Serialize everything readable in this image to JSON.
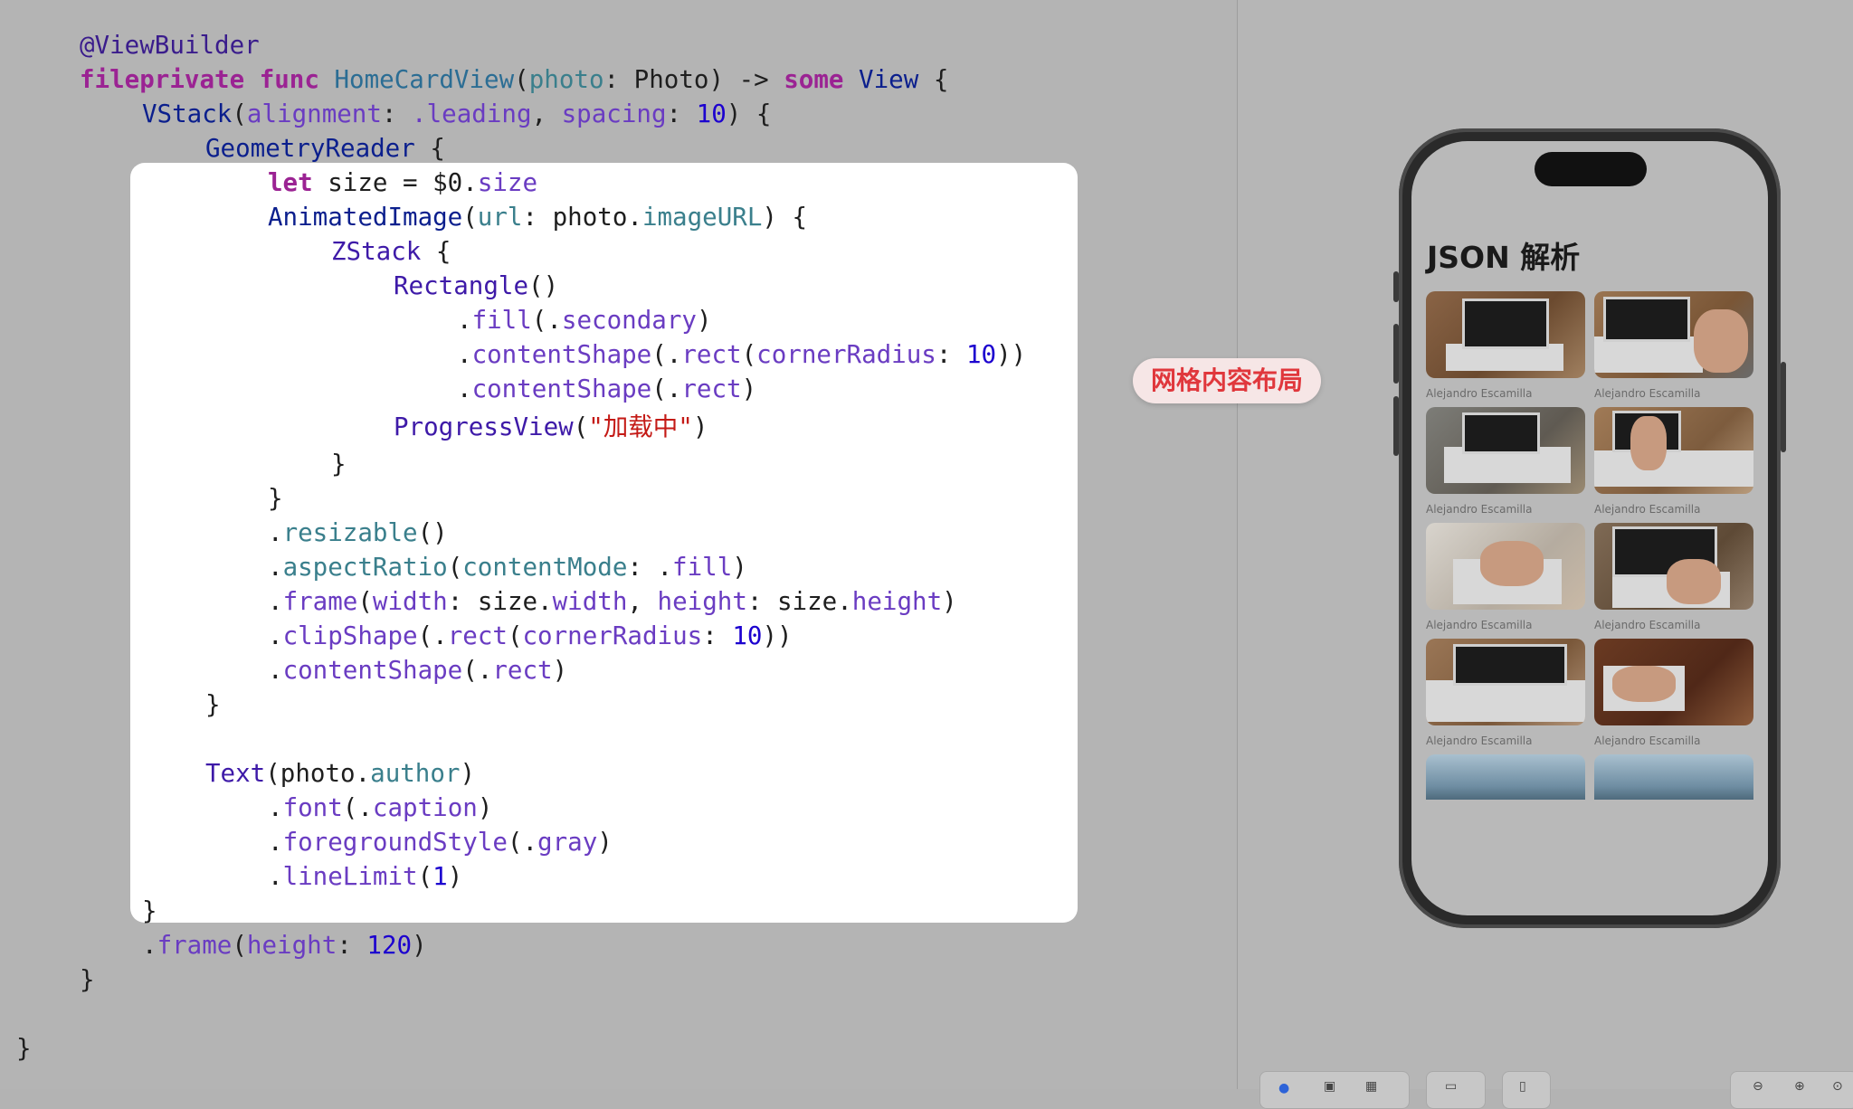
{
  "code": {
    "l1": "@ViewBuilder",
    "l2_kw1": "fileprivate",
    "l2_kw2": "func",
    "l2_name": "HomeCardView",
    "l2_p": "photo",
    "l2_t": "Photo",
    "l2_arrow": ") ->",
    "l2_kw3": "some",
    "l2_ret": "View",
    "l3_type": "VStack",
    "l3_a1": "alignment",
    "l3_v1": ".leading",
    "l3_a2": "spacing",
    "l3_n": "10",
    "l4_type": "GeometryReader",
    "l5_kw": "let",
    "l5_rest": "size = $0.",
    "l5_mem": "size",
    "l6_type": "AnimatedImage",
    "l6_a": "url",
    "l6_obj": "photo.",
    "l6_mem": "imageURL",
    "l7_type": "ZStack",
    "l8_type": "Rectangle",
    "l9_m": "fill",
    "l9_v": "secondary",
    "l10_m": "contentShape",
    "l10_v": "rect",
    "l10_a": "cornerRadius",
    "l10_n": "10",
    "l11_m": "contentShape",
    "l11_v": "rect",
    "l12_type": "ProgressView",
    "l12_str": "\"加载中\"",
    "l15_m": "resizable",
    "l16_m": "aspectRatio",
    "l16_a": "contentMode",
    "l16_v": "fill",
    "l17_m": "frame",
    "l17_a1": "width",
    "l17_v1": "width",
    "l17_a2": "height",
    "l17_v2": "height",
    "l18_m": "clipShape",
    "l18_v": "rect",
    "l18_a": "cornerRadius",
    "l18_n": "10",
    "l19_m": "contentShape",
    "l19_v": "rect",
    "l21_type": "Text",
    "l21_obj": "photo.",
    "l21_mem": "author",
    "l22_m": "font",
    "l22_v": "caption",
    "l23_m": "foregroundStyle",
    "l23_v": "gray",
    "l24_m": "lineLimit",
    "l24_n": "1",
    "l26_m": "frame",
    "l26_a": "height",
    "l26_n": "120"
  },
  "badge": "网格内容布局",
  "preview": {
    "title": "JSON 解析",
    "caption": "Alejandro Escamilla"
  }
}
